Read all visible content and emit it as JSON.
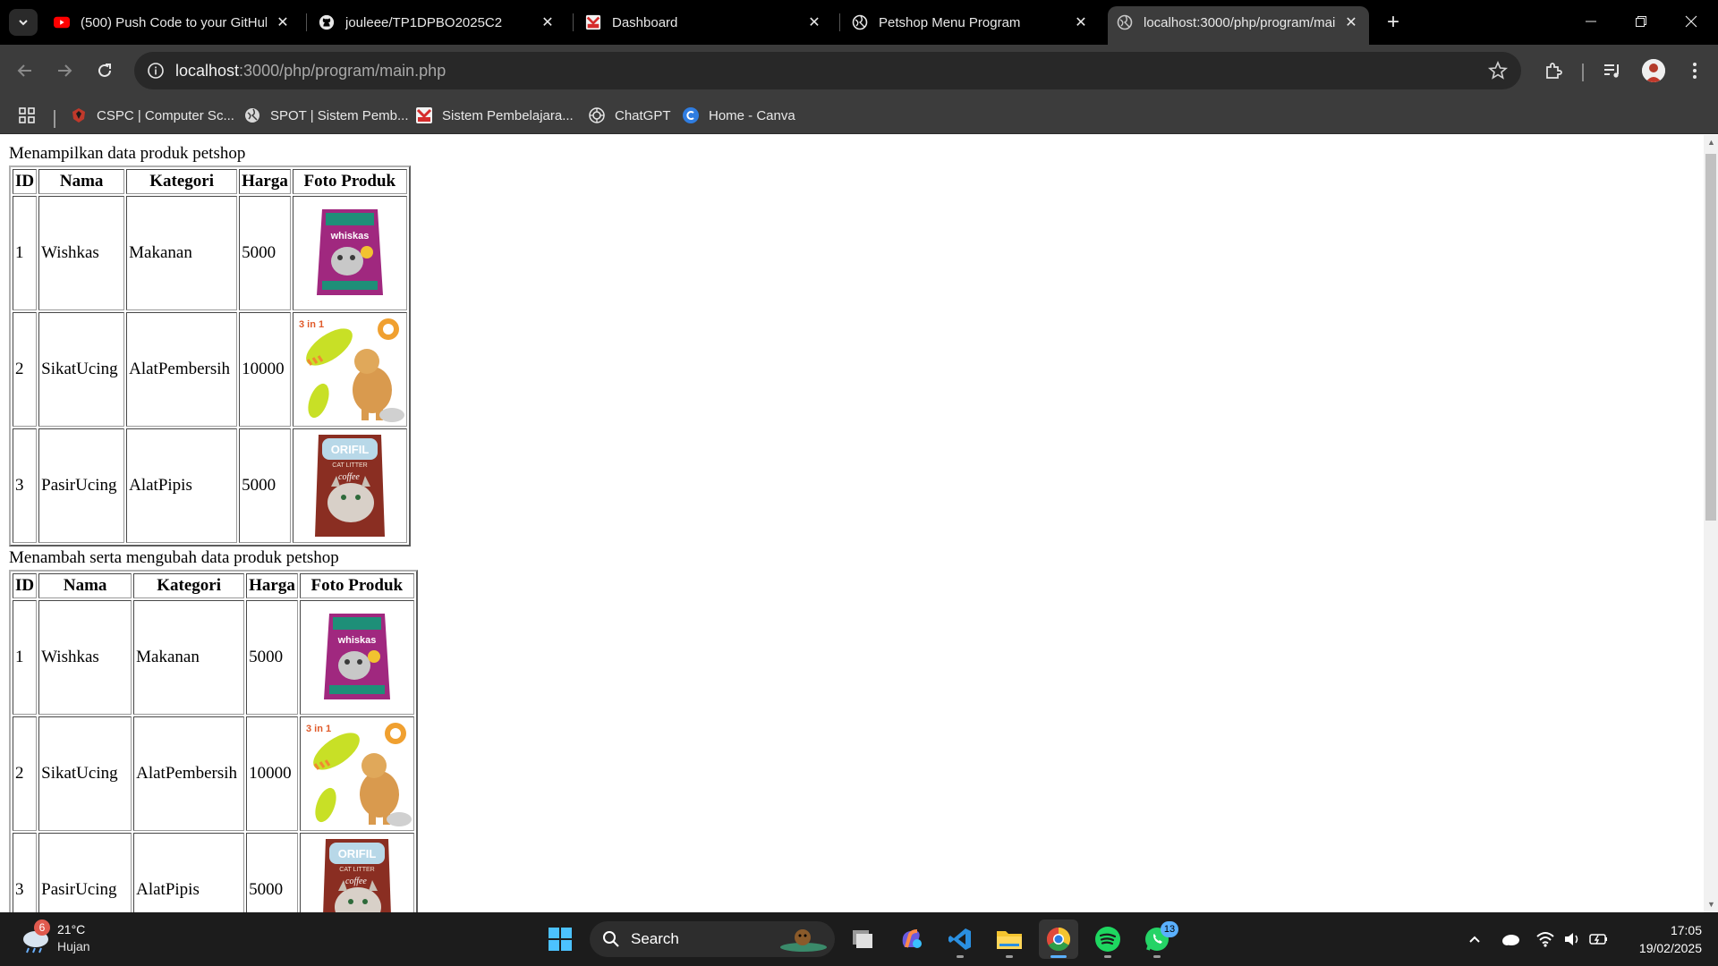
{
  "tabs": [
    {
      "title": "(500) Push Code to your GitHub",
      "icon": "youtube-icon"
    },
    {
      "title": "jouleee/TP1DPBO2025C2",
      "icon": "github-icon"
    },
    {
      "title": "Dashboard",
      "icon": "dashboard-icon"
    },
    {
      "title": "Petshop Menu Program",
      "icon": "globe-icon"
    },
    {
      "title": "localhost:3000/php/program/main.php",
      "icon": "globe-icon",
      "active": true
    }
  ],
  "address_bar": {
    "host": "localhost",
    "path": ":3000/php/program/main.php"
  },
  "bookmarks": [
    {
      "label": "CSPC | Computer Sc...",
      "icon": "cspc-icon"
    },
    {
      "label": "SPOT | Sistem Pemb...",
      "icon": "globe-icon"
    },
    {
      "label": "Sistem Pembelajara...",
      "icon": "sistem-icon"
    },
    {
      "label": "ChatGPT",
      "icon": "chatgpt-icon"
    },
    {
      "label": "Home - Canva",
      "icon": "canva-icon"
    }
  ],
  "page": {
    "section1_title": "Menampilkan data produk petshop",
    "section2_title": "Menambah serta mengubah data produk petshop",
    "headers": [
      "ID",
      "Nama",
      "Kategori",
      "Harga",
      "Foto Produk"
    ],
    "products": [
      {
        "id": "1",
        "nama": "Wishkas",
        "kategori": "Makanan",
        "harga": "5000",
        "foto": "whiskas-bag"
      },
      {
        "id": "2",
        "nama": "SikatUcing",
        "kategori": "AlatPembersih",
        "harga": "10000",
        "foto": "pet-brush"
      },
      {
        "id": "3",
        "nama": "PasirUcing",
        "kategori": "AlatPipis",
        "harga": "5000",
        "foto": "cat-litter-bag"
      }
    ],
    "image_texts": {
      "brush_badge": "3 in 1",
      "litter_brand": "ORIFIL",
      "litter_sub": "CAT LITTER",
      "litter_flavor": "coffee",
      "whiskas_brand": "whiskas"
    }
  },
  "taskbar": {
    "weather": {
      "temp": "21°C",
      "condition": "Hujan",
      "badge": "6"
    },
    "search_label": "Search",
    "whatsapp_badge": "13",
    "time": "17:05",
    "date": "19/02/2025"
  }
}
